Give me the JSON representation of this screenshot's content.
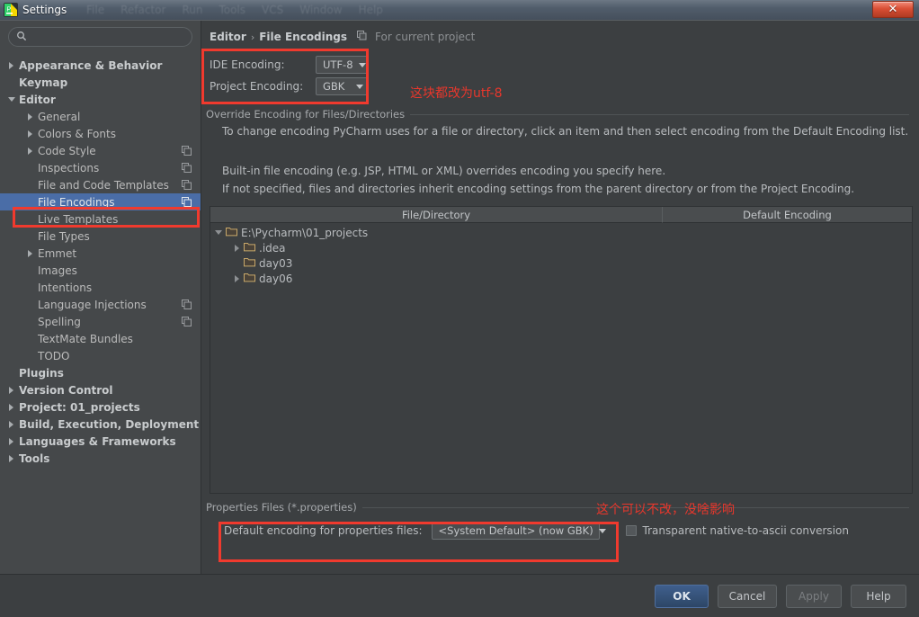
{
  "window": {
    "title": "Settings",
    "close_label": "✕",
    "ghost_menu": [
      "File",
      "Refactor",
      "Run",
      "Tools",
      "VCS",
      "Window",
      "Help"
    ]
  },
  "sidebar": {
    "search": {
      "value": "",
      "placeholder": ""
    },
    "items": [
      {
        "label": "Appearance & Behavior",
        "level": 0,
        "arrow": "right",
        "bold": true,
        "copy": false,
        "selected": false
      },
      {
        "label": "Keymap",
        "level": 0,
        "arrow": "none",
        "bold": true,
        "copy": false,
        "selected": false
      },
      {
        "label": "Editor",
        "level": 0,
        "arrow": "down",
        "bold": true,
        "copy": false,
        "selected": false
      },
      {
        "label": "General",
        "level": 1,
        "arrow": "right",
        "bold": false,
        "copy": false,
        "selected": false
      },
      {
        "label": "Colors & Fonts",
        "level": 1,
        "arrow": "right",
        "bold": false,
        "copy": false,
        "selected": false
      },
      {
        "label": "Code Style",
        "level": 1,
        "arrow": "right",
        "bold": false,
        "copy": true,
        "selected": false
      },
      {
        "label": "Inspections",
        "level": 1,
        "arrow": "none",
        "bold": false,
        "copy": true,
        "selected": false
      },
      {
        "label": "File and Code Templates",
        "level": 1,
        "arrow": "none",
        "bold": false,
        "copy": true,
        "selected": false
      },
      {
        "label": "File Encodings",
        "level": 1,
        "arrow": "none",
        "bold": false,
        "copy": true,
        "selected": true
      },
      {
        "label": "Live Templates",
        "level": 1,
        "arrow": "none",
        "bold": false,
        "copy": false,
        "selected": false
      },
      {
        "label": "File Types",
        "level": 1,
        "arrow": "none",
        "bold": false,
        "copy": false,
        "selected": false
      },
      {
        "label": "Emmet",
        "level": 1,
        "arrow": "right",
        "bold": false,
        "copy": false,
        "selected": false
      },
      {
        "label": "Images",
        "level": 1,
        "arrow": "none",
        "bold": false,
        "copy": false,
        "selected": false
      },
      {
        "label": "Intentions",
        "level": 1,
        "arrow": "none",
        "bold": false,
        "copy": false,
        "selected": false
      },
      {
        "label": "Language Injections",
        "level": 1,
        "arrow": "none",
        "bold": false,
        "copy": true,
        "selected": false
      },
      {
        "label": "Spelling",
        "level": 1,
        "arrow": "none",
        "bold": false,
        "copy": true,
        "selected": false
      },
      {
        "label": "TextMate Bundles",
        "level": 1,
        "arrow": "none",
        "bold": false,
        "copy": false,
        "selected": false
      },
      {
        "label": "TODO",
        "level": 1,
        "arrow": "none",
        "bold": false,
        "copy": false,
        "selected": false
      },
      {
        "label": "Plugins",
        "level": 0,
        "arrow": "none",
        "bold": true,
        "copy": false,
        "selected": false
      },
      {
        "label": "Version Control",
        "level": 0,
        "arrow": "right",
        "bold": true,
        "copy": false,
        "selected": false
      },
      {
        "label": "Project: 01_projects",
        "level": 0,
        "arrow": "right",
        "bold": true,
        "copy": false,
        "selected": false
      },
      {
        "label": "Build, Execution, Deployment",
        "level": 0,
        "arrow": "right",
        "bold": true,
        "copy": false,
        "selected": false
      },
      {
        "label": "Languages & Frameworks",
        "level": 0,
        "arrow": "right",
        "bold": true,
        "copy": false,
        "selected": false
      },
      {
        "label": "Tools",
        "level": 0,
        "arrow": "right",
        "bold": true,
        "copy": false,
        "selected": false
      }
    ]
  },
  "main": {
    "breadcrumb": {
      "parent": "Editor",
      "separator": "›",
      "current": "File Encodings",
      "scope": "For current project"
    },
    "ide_encoding": {
      "label": "IDE Encoding:",
      "value": "UTF-8"
    },
    "project_encoding": {
      "label": "Project Encoding:",
      "value": "GBK"
    },
    "override_group": {
      "title": "Override Encoding for Files/Directories"
    },
    "description": [
      "To change encoding PyCharm uses for a file or directory, click an item and then select encoding from the Default Encoding list.",
      "",
      "Built-in file encoding (e.g. JSP, HTML or XML) overrides encoding you specify here.",
      "If not specified, files and directories inherit encoding settings from the parent directory or from the Project Encoding."
    ],
    "table": {
      "columns": [
        "File/Directory",
        "Default Encoding"
      ],
      "rows": [
        {
          "name": "E:\\Pycharm\\01_projects",
          "indent": 0,
          "arrow": "down",
          "encoding": ""
        },
        {
          "name": ".idea",
          "indent": 1,
          "arrow": "right",
          "encoding": ""
        },
        {
          "name": "day03",
          "indent": 1,
          "arrow": "none",
          "encoding": ""
        },
        {
          "name": "day06",
          "indent": 1,
          "arrow": "right",
          "encoding": ""
        }
      ]
    },
    "properties_group": {
      "title": "Properties Files (*.properties)"
    },
    "properties_encoding": {
      "label": "Default encoding for properties files:",
      "value": "<System Default> (now GBK)"
    },
    "transparent_checkbox": {
      "label": "Transparent native-to-ascii conversion",
      "checked": false
    }
  },
  "footer": {
    "ok": "OK",
    "cancel": "Cancel",
    "apply": "Apply",
    "help": "Help"
  },
  "annotations": {
    "note_encoding": "这块都改为utf-8",
    "note_properties": "这个可以不改，没啥影响",
    "color": "#e8372c"
  }
}
